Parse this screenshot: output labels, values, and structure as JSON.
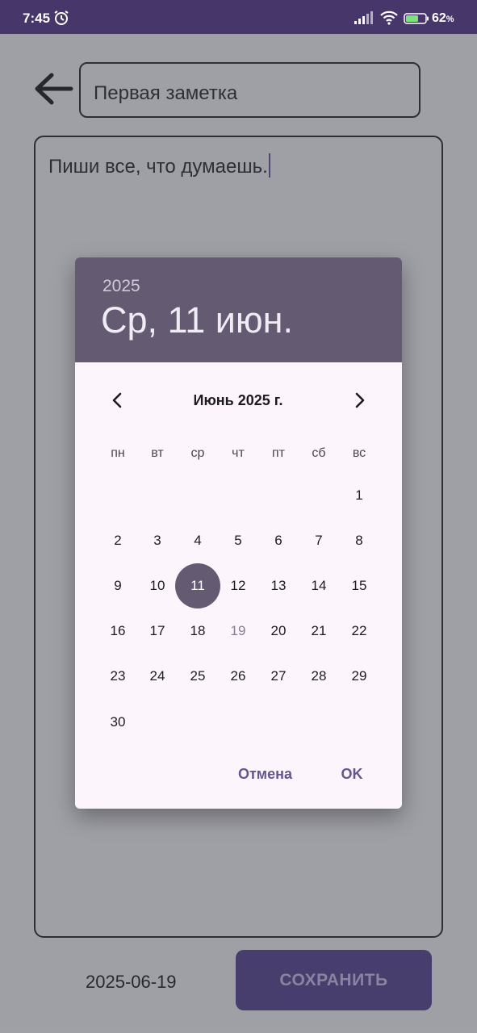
{
  "status_bar": {
    "time": "7:45",
    "battery_percent": "62",
    "battery_unit": "%",
    "icons": [
      "alarm-icon",
      "signal-icon",
      "wifi-icon",
      "battery-icon"
    ]
  },
  "editor": {
    "title_value": "Первая заметка",
    "note_text": "Пиши все, что думаешь.",
    "date_value": "2025-06-19",
    "save_label": "СОХРАНИТЬ"
  },
  "date_picker": {
    "year": "2025",
    "selected_date_text": "Ср, 11 июн.",
    "month_label": "Июнь 2025 г.",
    "weekdays": [
      "пн",
      "вт",
      "ср",
      "чт",
      "пт",
      "сб",
      "вс"
    ],
    "days": [
      "1",
      "2",
      "3",
      "4",
      "5",
      "6",
      "7",
      "8",
      "9",
      "10",
      "11",
      "12",
      "13",
      "14",
      "15",
      "16",
      "17",
      "18",
      "19",
      "20",
      "21",
      "22",
      "23",
      "24",
      "25",
      "26",
      "27",
      "28",
      "29",
      "30"
    ],
    "first_day_weekday_index": 6,
    "selected_day": 11,
    "today_day": 19,
    "cancel_label": "Отмена",
    "ok_label": "OK"
  },
  "colors": {
    "status_bar": "#463669",
    "header": "#645b72",
    "accent": "#63558f",
    "save_button": "#3c2e62",
    "dialog_bg": "#fcf6fc"
  }
}
